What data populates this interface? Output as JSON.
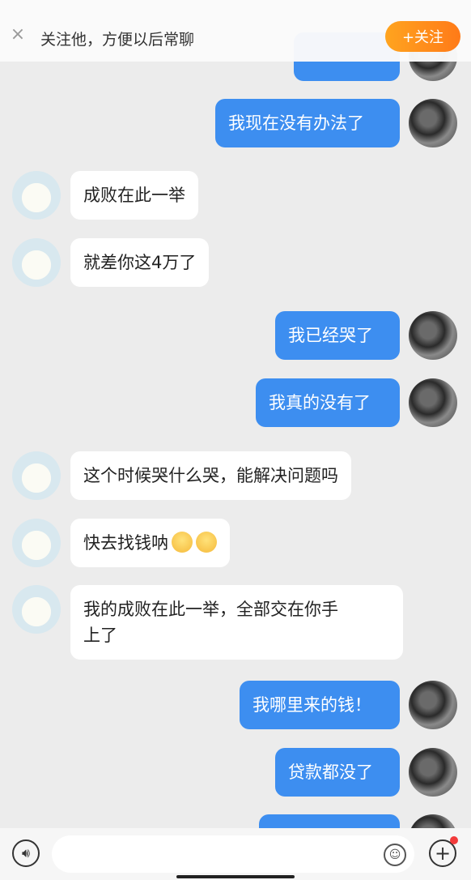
{
  "follow_bar": {
    "close_icon": "×",
    "tip": "关注他，方便以后常聊",
    "follow_button": "+关注"
  },
  "messages": [
    {
      "side": "right",
      "text": "",
      "cut": "top"
    },
    {
      "side": "right",
      "text": "我现在没有办法了"
    },
    {
      "side": "left",
      "text": "成败在此一举"
    },
    {
      "side": "left",
      "text": "就差你这4万了"
    },
    {
      "side": "right",
      "text": "我已经哭了"
    },
    {
      "side": "right",
      "text": "我真的没有了"
    },
    {
      "side": "left",
      "text": "这个时候哭什么哭，能解决问题吗"
    },
    {
      "side": "left",
      "text": "快去找钱呐",
      "emoji_count": 2
    },
    {
      "side": "left",
      "line1": "我的成败在此一举，全部交在你手",
      "line2": "上了"
    },
    {
      "side": "right",
      "text": "我哪里来的钱！"
    },
    {
      "side": "right",
      "text": "贷款都没了"
    },
    {
      "side": "right",
      "text": "",
      "cut": "bottom"
    }
  ],
  "composer": {
    "voice_icon": "voice-icon",
    "emoji_icon": "emoji-icon",
    "plus_icon": "plus-icon",
    "notification_dot_color": "#f23b3b"
  },
  "colors": {
    "accent_orange": "#ff8a1a",
    "bubble_blue": "#3d8ef0"
  }
}
